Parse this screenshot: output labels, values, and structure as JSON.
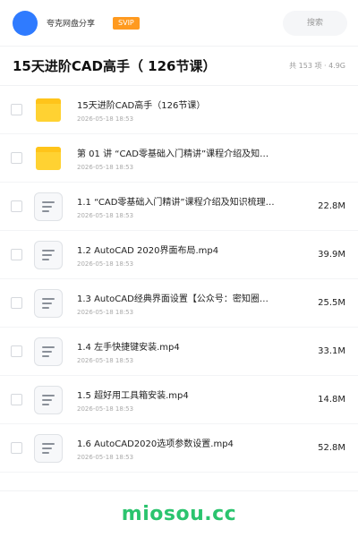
{
  "header": {
    "username": "夸克网盘分享",
    "badge": "SVIP",
    "search_placeholder": "搜索",
    "colors": {
      "avatar": "#2f7bff",
      "badge": "#ff9a1f"
    }
  },
  "titlebar": {
    "title": "15天进阶CAD高手（ 126节课）",
    "meta": "共 153 项 · 4.9G"
  },
  "items": [
    {
      "type": "folder",
      "icon": "folder-icon",
      "name": "15天进阶CAD高手（126节课）",
      "date": "2026-05-18 18:53",
      "size": ""
    },
    {
      "type": "folder",
      "icon": "folder-icon",
      "name": "第 01 讲 “CAD零基础入门精讲”课程介绍及知…",
      "date": "2026-05-18 18:53",
      "size": ""
    },
    {
      "type": "file",
      "icon": "document-icon",
      "name": "1.1 “CAD零基础入门精讲”课程介绍及知识梳理…",
      "date": "2026-05-18 18:53",
      "size": "22.8M"
    },
    {
      "type": "file",
      "icon": "document-icon",
      "name": "1.2 AutoCAD 2020界面布局.mp4",
      "date": "2026-05-18 18:53",
      "size": "39.9M"
    },
    {
      "type": "file",
      "icon": "document-icon",
      "name": "1.3 AutoCAD经典界面设置【公众号：密知圈…",
      "date": "2026-05-18 18:53",
      "size": "25.5M"
    },
    {
      "type": "file",
      "icon": "document-icon",
      "name": "1.4 左手快捷键安装.mp4",
      "date": "2026-05-18 18:53",
      "size": "33.1M"
    },
    {
      "type": "file",
      "icon": "document-icon",
      "name": "1.5 超好用工具箱安装.mp4",
      "date": "2026-05-18 18:53",
      "size": "14.8M"
    },
    {
      "type": "file",
      "icon": "document-icon",
      "name": "1.6 AutoCAD2020选项参数设置.mp4",
      "date": "2026-05-18 18:53",
      "size": "52.8M"
    }
  ],
  "footer": {
    "watermark": "miosou.cc",
    "color": "#2bc46e"
  }
}
